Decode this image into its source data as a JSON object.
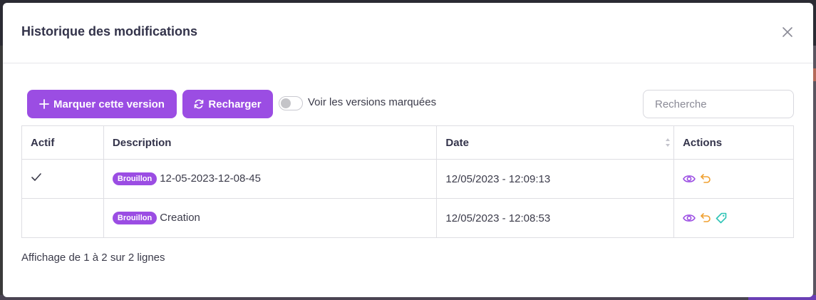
{
  "modal": {
    "title": "Historique des modifications"
  },
  "toolbar": {
    "mark_label": "Marquer cette version",
    "reload_label": "Recharger",
    "toggle_label": "Voir les versions marquées",
    "toggle_on": false,
    "search_placeholder": "Recherche"
  },
  "table": {
    "headers": {
      "actif": "Actif",
      "description": "Description",
      "date": "Date",
      "actions": "Actions"
    },
    "rows": [
      {
        "active": true,
        "badge": "Brouillon",
        "description": "12-05-2023-12-08-45",
        "date": "12/05/2023 - 12:09:13",
        "actions": [
          "eye-icon",
          "undo-icon"
        ]
      },
      {
        "active": false,
        "badge": "Brouillon",
        "description": "Creation",
        "date": "12/05/2023 - 12:08:53",
        "actions": [
          "eye-icon",
          "undo-icon",
          "tag-icon"
        ]
      }
    ]
  },
  "footer": {
    "info": "Affichage de 1 à 2 sur 2 lignes"
  },
  "colors": {
    "accent": "#9b4de3",
    "undo": "#f0a030",
    "tag": "#2ec4b6"
  }
}
